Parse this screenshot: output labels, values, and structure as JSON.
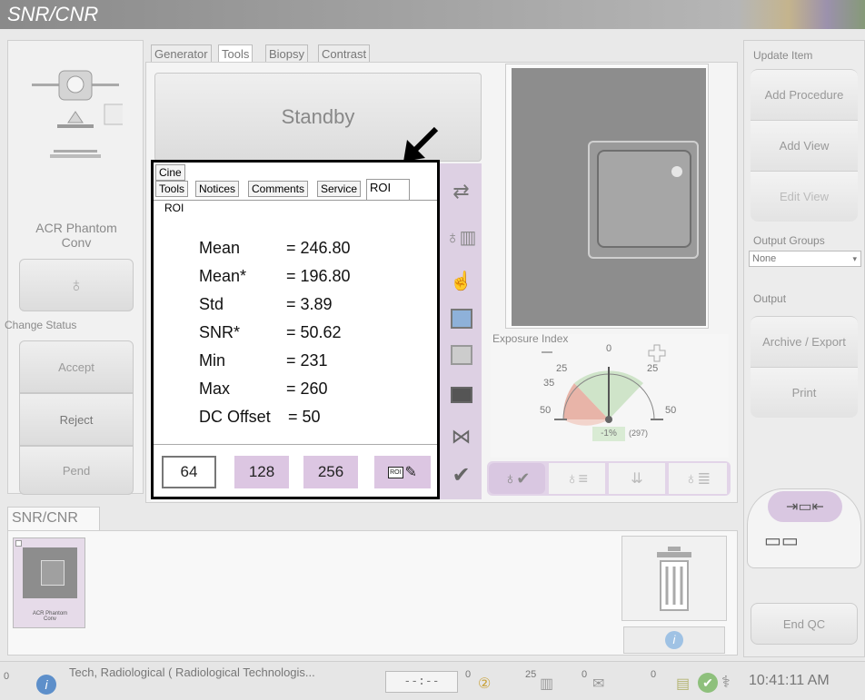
{
  "app": {
    "title": "SNR/CNR"
  },
  "left": {
    "procedure_label": "ACR Phantom\nConv",
    "change_status_label": "Change Status",
    "buttons": {
      "accept": "Accept",
      "reject": "Reject",
      "pend": "Pend"
    }
  },
  "center": {
    "tabs": [
      "Generator",
      "Tools",
      "Biopsy",
      "Contrast"
    ],
    "active_tab": "Tools",
    "status": "Standby",
    "exposure_index": {
      "label": "Exposure Index",
      "ticks": [
        "0",
        "25",
        "25",
        "35",
        "50",
        "50"
      ],
      "readout": "-1%",
      "readout_secondary": "(297)",
      "needle_value": 0
    }
  },
  "roi_panel": {
    "tabs_row1": [
      "Cine"
    ],
    "tabs_row2": [
      "Tools",
      "Notices",
      "Comments",
      "Service",
      "ROI"
    ],
    "active_tab": "ROI",
    "section_label": "ROI",
    "measurements": [
      {
        "label": "Mean",
        "value": "= 246.80"
      },
      {
        "label": "Mean*",
        "value": "= 196.80"
      },
      {
        "label": "Std",
        "value": "= 3.89"
      },
      {
        "label": "SNR*",
        "value": "= 50.62"
      },
      {
        "label": "Min",
        "value": "= 231"
      },
      {
        "label": "Max",
        "value": "= 260"
      },
      {
        "label": "DC Offset",
        "value": "= 50"
      }
    ],
    "size_buttons": [
      "64",
      "128",
      "256"
    ],
    "roi_button_label": "ROI"
  },
  "right": {
    "update_item_label": "Update Item",
    "buttons": {
      "add_procedure": "Add Procedure",
      "add_view": "Add View",
      "edit_view": "Edit View"
    },
    "output_groups_label": "Output Groups",
    "output_groups_value": "None",
    "output_label": "Output",
    "output_buttons": {
      "archive": "Archive / Export",
      "print": "Print"
    },
    "end_qc": "End QC"
  },
  "bottom": {
    "section_title": "SNR/CNR",
    "thumbnail_label": "ACR Phantom\nConv"
  },
  "statusbar": {
    "left_count": "0",
    "user": "Tech, Radiological ( Radiological Technologis...",
    "timer": "--:--",
    "count_a": "0",
    "count_b": "25",
    "count_c": "0",
    "count_d": "0",
    "clock": "10:41:11 AM"
  },
  "colors": {
    "accent_purple": "#dcc6e2",
    "gauge_green": "#cfe4c9",
    "gauge_red": "#e8b4a8"
  }
}
